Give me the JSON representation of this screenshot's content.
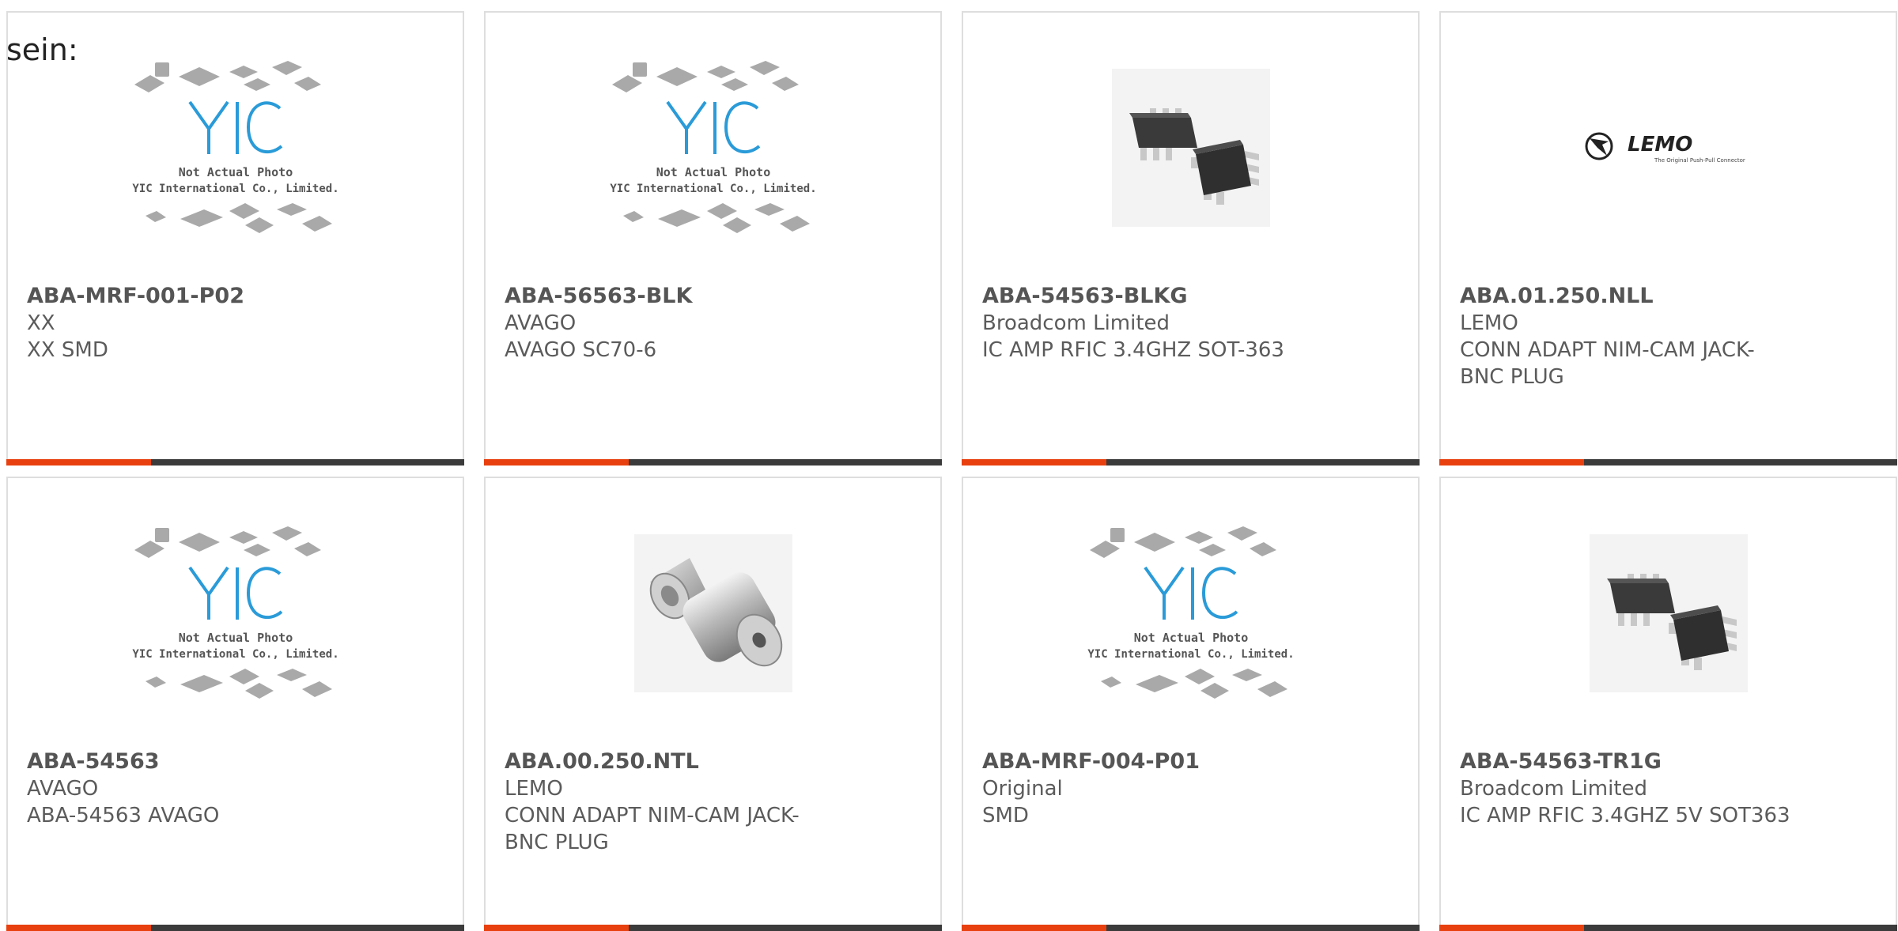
{
  "page": {
    "lead_text": "sein:"
  },
  "placeholder": {
    "logo": "YIC",
    "line1": "Not Actual Photo",
    "line2": "YIC International Co., Limited."
  },
  "lemo": {
    "brand": "LEMO",
    "tagline": "The Original Push-Pull Connector"
  },
  "colors": {
    "accent": "#e8400f",
    "bar": "#3b3b3b",
    "logo_blue": "#2a9bd8",
    "border": "#dedede"
  },
  "products": [
    {
      "part": "ABA-MRF-001-P02",
      "manufacturer": "XX",
      "description": "XX SMD",
      "image": "placeholder"
    },
    {
      "part": "ABA-56563-BLK",
      "manufacturer": "AVAGO",
      "description": "AVAGO SC70-6",
      "image": "placeholder"
    },
    {
      "part": "ABA-54563-BLKG",
      "manufacturer": "Broadcom Limited",
      "description": "IC AMP RFIC 3.4GHZ SOT-363",
      "image": "sot363"
    },
    {
      "part": "ABA.01.250.NLL",
      "manufacturer": "LEMO",
      "description": "CONN ADAPT NIM-CAM JACK-BNC PLUG",
      "image": "lemo-logo"
    },
    {
      "part": "ABA-54563",
      "manufacturer": "AVAGO",
      "description": "ABA-54563 AVAGO",
      "image": "placeholder"
    },
    {
      "part": "ABA.00.250.NTL",
      "manufacturer": "LEMO",
      "description": "CONN ADAPT NIM-CAM JACK-BNC PLUG",
      "image": "bnc-adapter"
    },
    {
      "part": "ABA-MRF-004-P01",
      "manufacturer": "Original",
      "description": "SMD",
      "image": "placeholder"
    },
    {
      "part": "ABA-54563-TR1G",
      "manufacturer": "Broadcom Limited",
      "description": "IC AMP RFIC 3.4GHZ 5V SOT363",
      "image": "sot363"
    }
  ]
}
